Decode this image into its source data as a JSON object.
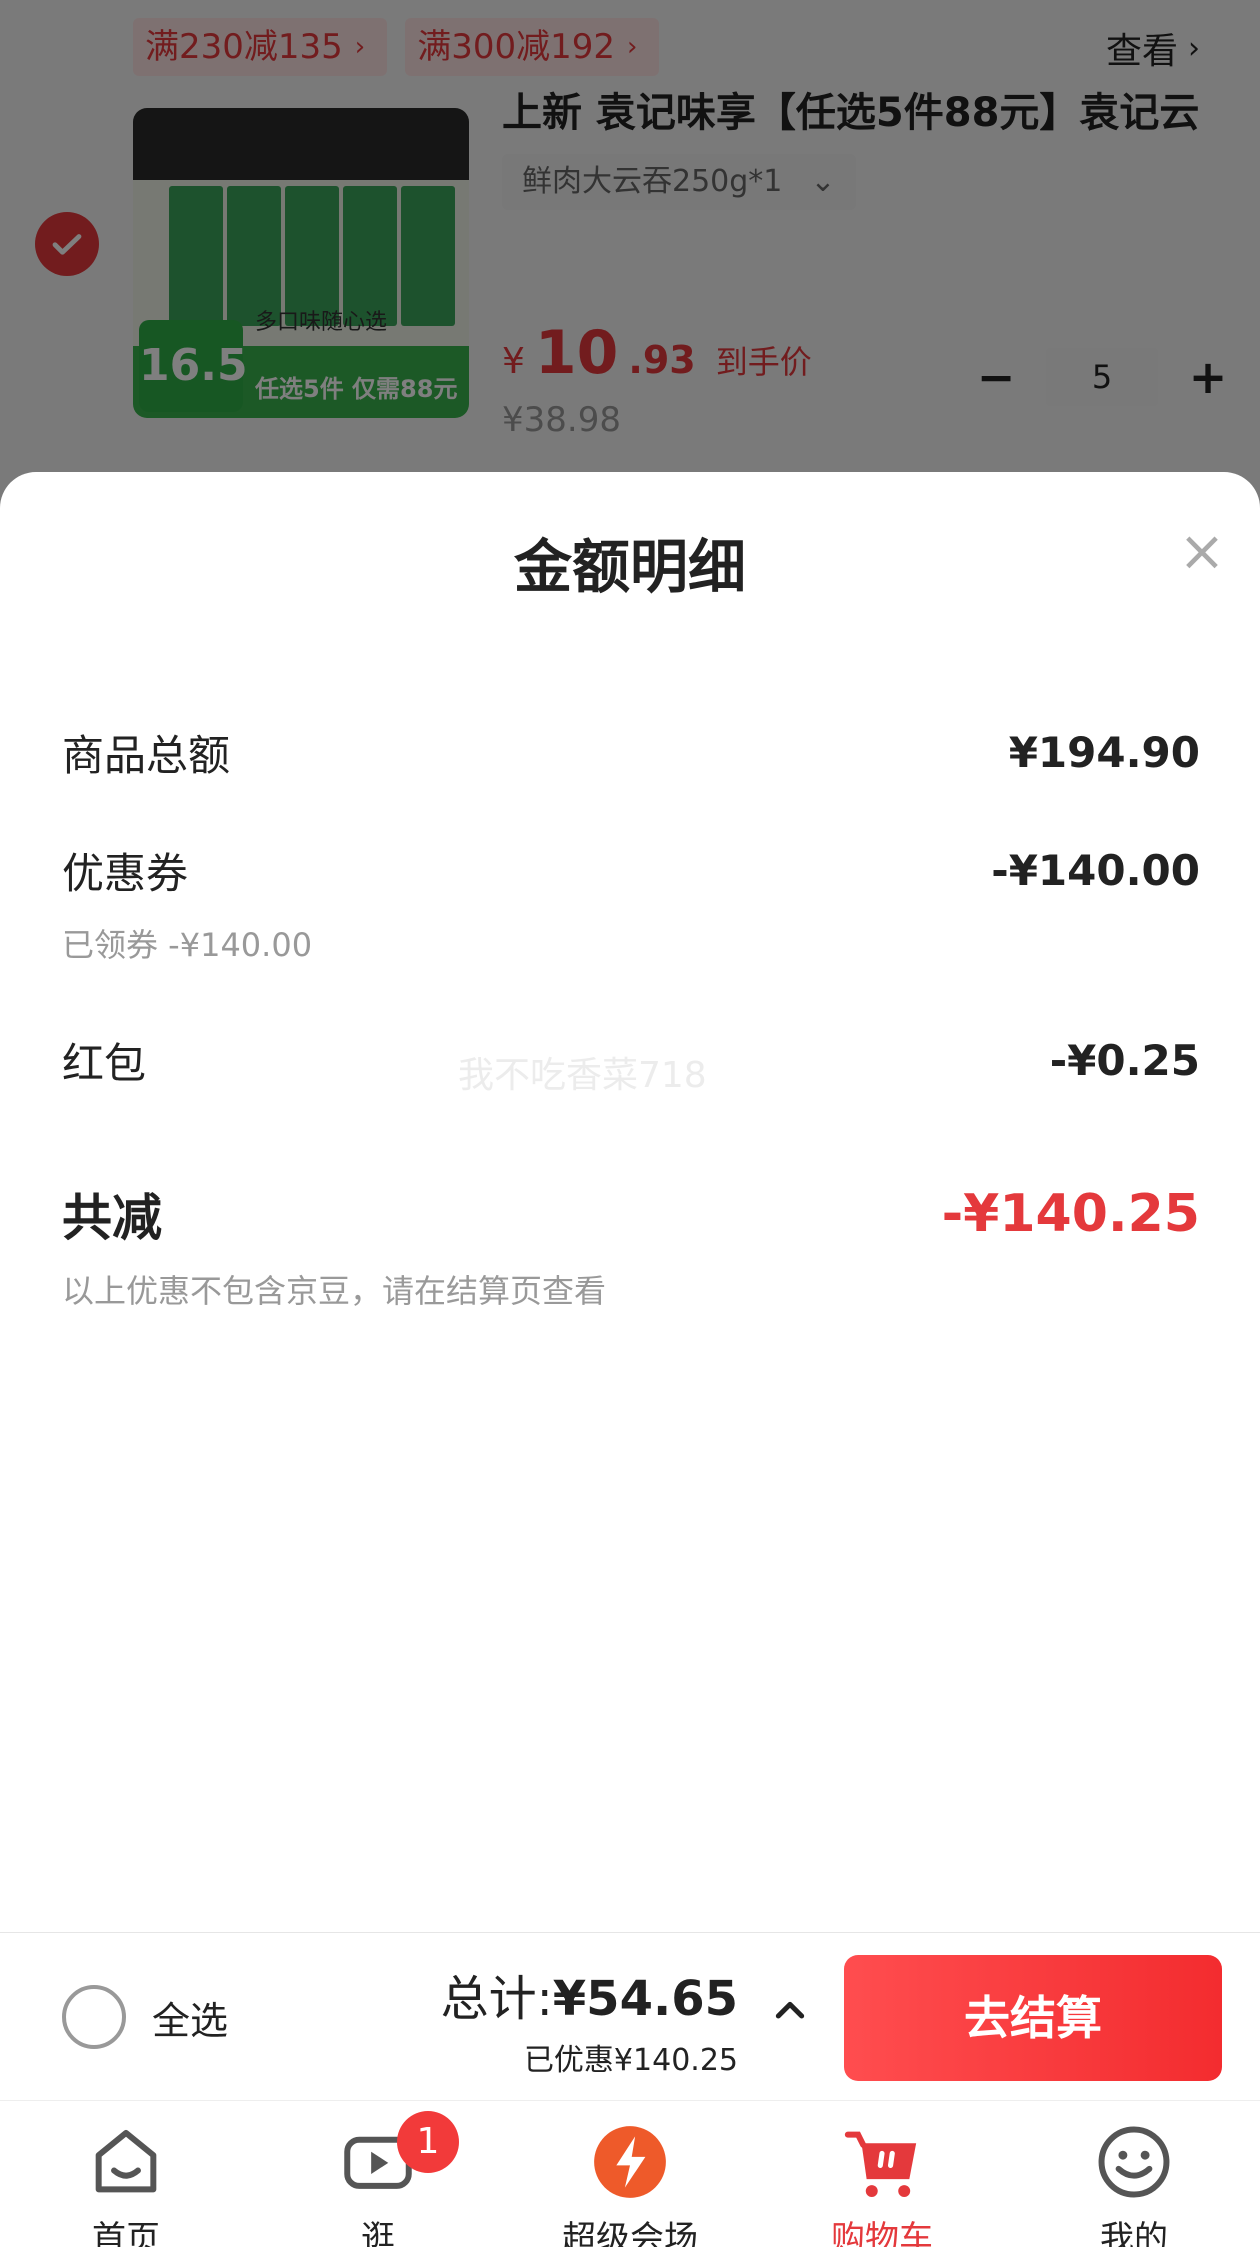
{
  "cart": {
    "promo_tags": [
      "满230减135",
      "满300减192"
    ],
    "view_label": "查看",
    "item": {
      "title": "上新 袁记味享【任选5件88元】袁记云",
      "spec": "鲜肉大云吞250g*1",
      "price_yen": "¥",
      "price_int": "10",
      "price_dec": ".93",
      "price_note": "到手价",
      "original_price": "¥38.98",
      "quantity": "5",
      "thumb_badge": "16.5",
      "thumb_middle": "多口味随心选",
      "thumb_footer": "任选5件 仅需88元"
    }
  },
  "sheet": {
    "title": "金额明细",
    "rows": {
      "goods_total": {
        "label": "商品总额",
        "amount": "¥194.90"
      },
      "coupon": {
        "label": "优惠券",
        "amount": "-¥140.00",
        "sub": "已领券 -¥140.00"
      },
      "red_packet": {
        "label": "红包",
        "amount": "-¥0.25"
      },
      "total_reduction": {
        "label": "共减",
        "amount": "-¥140.25",
        "note": "以上优惠不包含京豆，请在结算页查看"
      }
    },
    "watermark": "我不吃香菜718"
  },
  "checkout": {
    "select_all": "全选",
    "total_prefix": "总计:",
    "total_value": "¥54.65",
    "saved": "已优惠¥140.25",
    "pay_button": "去结算"
  },
  "tabbar": {
    "home": "首页",
    "browse": "逛",
    "browse_badge": "1",
    "super_venue": "超级会场",
    "cart": "购物车",
    "mine": "我的"
  },
  "colors": {
    "accent": "#e4393c",
    "pay_button": "#f32c2f",
    "tag_bg": "#fde3e3"
  }
}
